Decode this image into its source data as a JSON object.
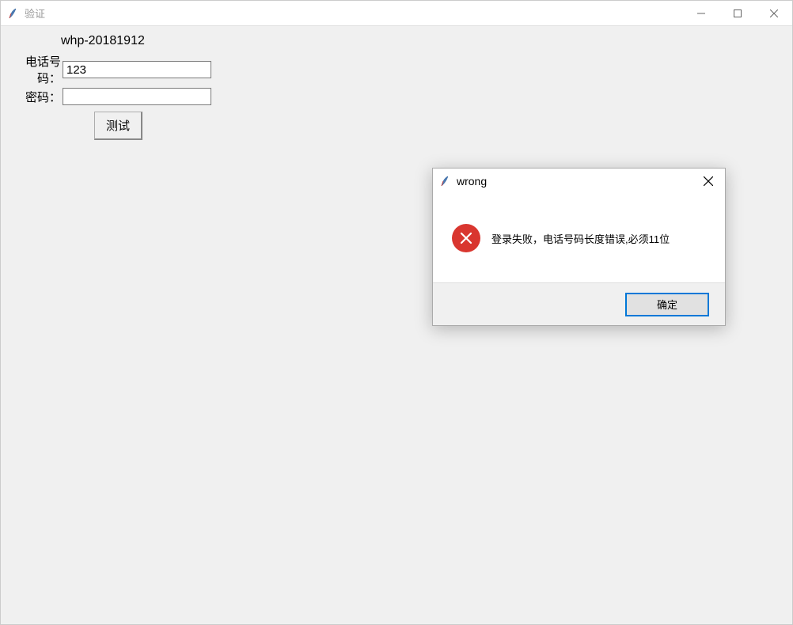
{
  "window": {
    "title": "验证",
    "controls": {
      "minimize": "minimize",
      "maximize": "maximize",
      "close": "close"
    }
  },
  "form": {
    "heading": "whp-20181912",
    "phone_label": "电话号码：",
    "phone_value": "123",
    "password_label": "密码：",
    "password_value": "",
    "test_button_label": "测试"
  },
  "dialog": {
    "title": "wrong",
    "message": "登录失败，电话号码长度错误,必须11位",
    "ok_label": "确定"
  },
  "colors": {
    "error_icon_bg": "#d9362f",
    "focus_border": "#0078d7"
  }
}
